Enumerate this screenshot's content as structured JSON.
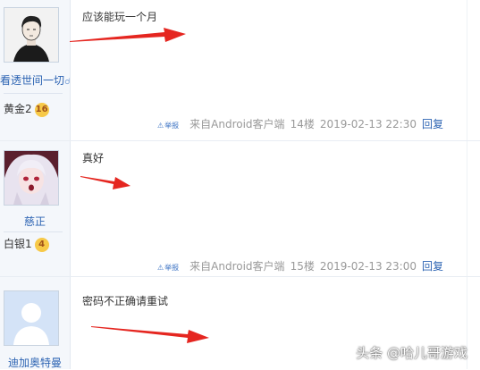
{
  "posts": [
    {
      "username": "看透世间一切",
      "gender_icon": "male-icon",
      "level_name": "黄金2",
      "level_num": "16",
      "content": "应该能玩一个月",
      "report": "举报",
      "client": "来自Android客户端",
      "floor": "14楼",
      "time": "2019-02-13 22:30",
      "reply": "回复"
    },
    {
      "username": "慈正",
      "level_name": "白银1",
      "level_num": "4",
      "content": "真好",
      "report": "举报",
      "client": "来自Android客户端",
      "floor": "15楼",
      "time": "2019-02-13 23:00",
      "reply": "回复"
    },
    {
      "username": "迪加奥特曼",
      "content": "密码不正确请重试"
    }
  ],
  "watermark": "头条 @哈儿哥游戏",
  "colors": {
    "link": "#2d64b3",
    "meta": "#999999",
    "arrow": "#e52620",
    "sidebar": "#f4f7fb"
  }
}
